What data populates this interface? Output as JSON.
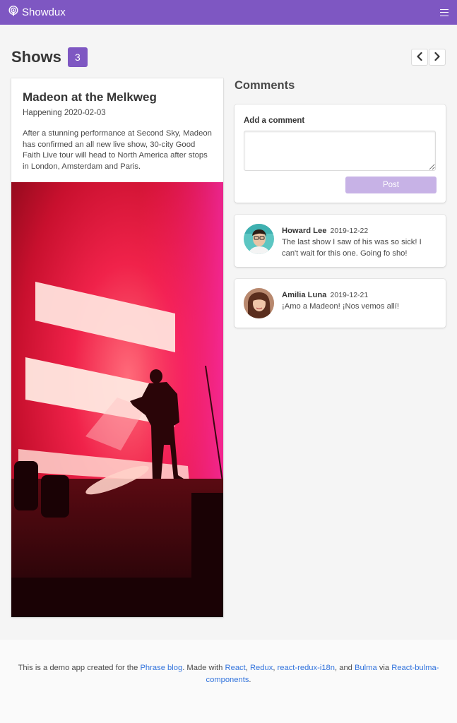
{
  "navbar": {
    "brand": "Showdux",
    "brand_icon": "podcast-icon",
    "menu_icon": "hamburger-icon",
    "background_color": "#7e57c2"
  },
  "shows": {
    "title": "Shows",
    "count": "3",
    "prev_icon": "chevron-left-icon",
    "next_icon": "chevron-right-icon"
  },
  "show": {
    "title": "Madeon at the Melkweg",
    "date": "Happening 2020-02-03",
    "description": "After a stunning performance at Second Sky, Madeon has confirmed an all new live show, 30-city Good Faith Live tour will head to North America after stops in London, Amsterdam and Paris."
  },
  "comments": {
    "heading": "Comments",
    "form": {
      "label": "Add a comment",
      "value": "",
      "post_label": "Post"
    },
    "items": [
      {
        "author": "Howard Lee",
        "date": "2019-12-22",
        "text": "The last show I saw of his was so sick! I can't wait for this one. Going fo sho!"
      },
      {
        "author": "Amilia Luna",
        "date": "2019-12-21",
        "text": "¡Amo a Madeon! ¡Nos vemos allí!"
      }
    ]
  },
  "footer": {
    "text_1": "This is a demo app created for the ",
    "link_1": "Phrase blog",
    "text_2": ". Made with ",
    "link_2": "React",
    "text_3": ", ",
    "link_3": "Redux",
    "text_4": ", ",
    "link_4": "react-redux-i18n",
    "text_5": ", and ",
    "link_5": "Bulma",
    "text_6": " via ",
    "link_6": "React-bulma-components",
    "text_7": ".",
    "link_color": "#3273dc"
  }
}
